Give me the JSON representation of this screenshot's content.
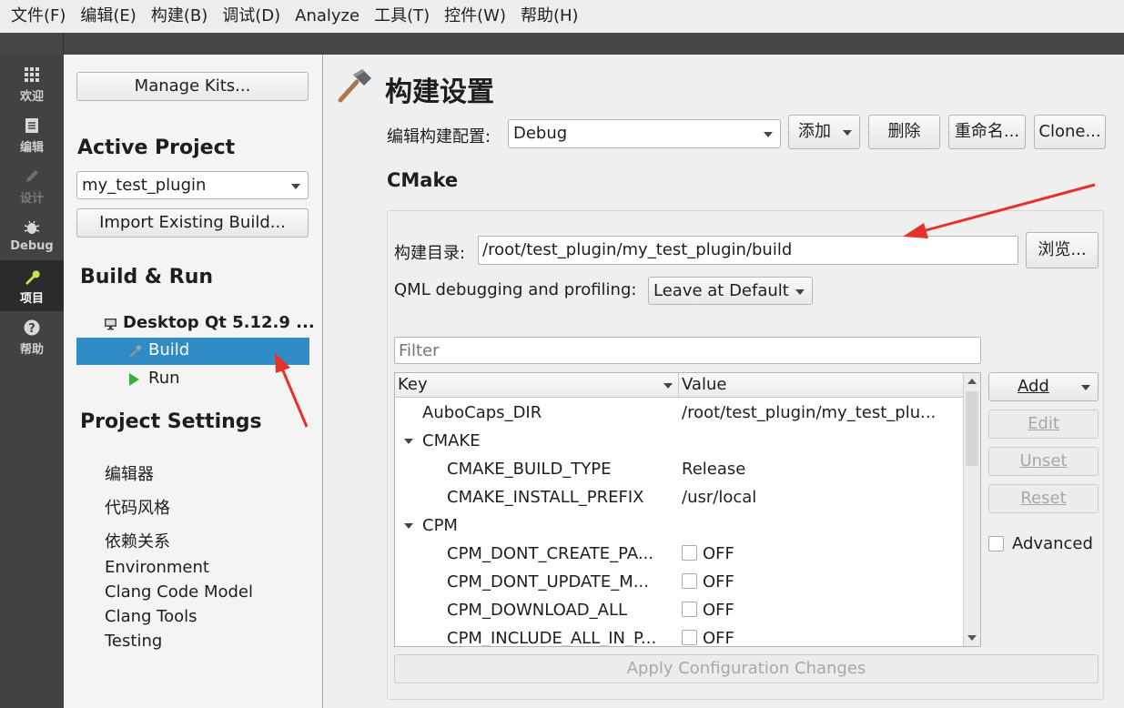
{
  "menu": [
    "文件(F)",
    "编辑(E)",
    "构建(B)",
    "调试(D)",
    "Analyze",
    "工具(T)",
    "控件(W)",
    "帮助(H)"
  ],
  "modes": [
    {
      "label": "欢迎",
      "icon": "grid-icon"
    },
    {
      "label": "编辑",
      "icon": "document-icon"
    },
    {
      "label": "设计",
      "icon": "pencil-icon"
    },
    {
      "label": "Debug",
      "icon": "bug-icon"
    },
    {
      "label": "项目",
      "icon": "wrench-icon"
    },
    {
      "label": "帮助",
      "icon": "help-icon"
    }
  ],
  "nav": {
    "manage_kits": "Manage Kits...",
    "active_project_heading": "Active Project",
    "project_select": "my_test_plugin",
    "import_build": "Import Existing Build...",
    "build_run_heading": "Build & Run",
    "kit_name": "Desktop Qt 5.12.9 ...",
    "build_item": "Build",
    "run_item": "Run",
    "project_settings_heading": "Project Settings",
    "settings_items": [
      "编辑器",
      "代码风格",
      "依赖关系",
      "Environment",
      "Clang Code Model",
      "Clang Tools",
      "Testing"
    ]
  },
  "main": {
    "title": "构建设置",
    "edit_config_label": "编辑构建配置:",
    "config_select": "Debug",
    "add_label": "添加",
    "delete_label": "删除",
    "rename_label": "重命名...",
    "clone_label": "Clone...",
    "cmake_heading": "CMake",
    "build_dir_label": "构建目录:",
    "build_dir_value": "/root/test_plugin/my_test_plugin/build",
    "browse_label": "浏览...",
    "qml_label": "QML debugging and profiling:",
    "qml_select": "Leave at Default",
    "filter_placeholder": "Filter",
    "table": {
      "col_key": "Key",
      "col_value": "Value",
      "rows": [
        {
          "key": "AuboCaps_DIR",
          "value": "/root/test_plugin/my_test_plu...",
          "level": 0
        },
        {
          "key": "CMAKE",
          "value": "",
          "level": 0,
          "group": true
        },
        {
          "key": "CMAKE_BUILD_TYPE",
          "value": "Release",
          "level": 1
        },
        {
          "key": "CMAKE_INSTALL_PREFIX",
          "value": "/usr/local",
          "level": 1
        },
        {
          "key": "CPM",
          "value": "",
          "level": 0,
          "group": true
        },
        {
          "key": "CPM_DONT_CREATE_PA...",
          "value": "OFF",
          "level": 1,
          "checkbox": true
        },
        {
          "key": "CPM_DONT_UPDATE_M...",
          "value": "OFF",
          "level": 1,
          "checkbox": true
        },
        {
          "key": "CPM_DOWNLOAD_ALL",
          "value": "OFF",
          "level": 1,
          "checkbox": true
        },
        {
          "key": "CPM_INCLUDE_ALL_IN_P...",
          "value": "OFF",
          "level": 1,
          "checkbox": true
        }
      ]
    },
    "side_buttons": {
      "add": "Add",
      "edit": "Edit",
      "unset": "Unset",
      "reset": "Reset"
    },
    "advanced_label": "Advanced",
    "apply_label": "Apply Configuration Changes"
  },
  "colors": {
    "selection": "#308cc6",
    "annotation_arrow": "#e8302a",
    "run_triangle": "#3bab3b"
  }
}
